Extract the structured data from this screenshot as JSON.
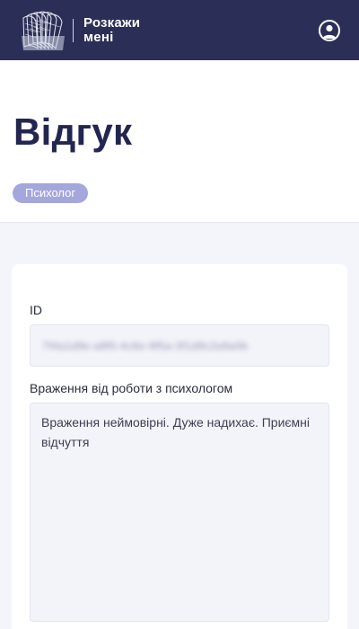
{
  "header": {
    "brand_line1": "Розкажи",
    "brand_line2": "мені",
    "logo_icon": "book-pages-logo-icon",
    "profile_icon": "user-circle-icon",
    "background_color": "#2b2f57"
  },
  "page": {
    "title": "Відгук",
    "role_badge": "Психолог",
    "badge_color": "#a4a7dc"
  },
  "form": {
    "id_label": "ID",
    "id_value": "7f4a1d9e-a8f0-4c6e-9f5a-3f1d9c2e6a0b",
    "feedback_label": "Враження від роботи з психологом",
    "feedback_value": "Враження неймовірні. Дуже надихає. Приємні відчуття"
  }
}
